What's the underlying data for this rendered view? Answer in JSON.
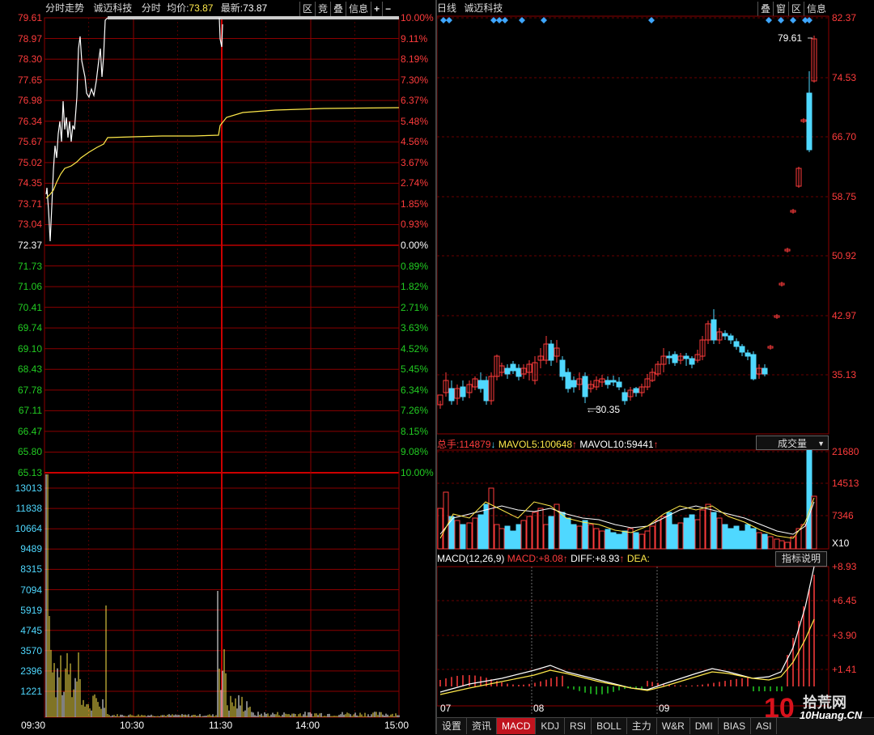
{
  "intraday": {
    "header": {
      "title": "分时走势",
      "stock": "诚迈科技",
      "mode": "分时",
      "avg_label": "均价:",
      "avg_value": "73.87",
      "last_label": "最新:",
      "last_value": "73.87",
      "buttons": [
        "区",
        "竞",
        "叠",
        "信息",
        "+",
        "−"
      ]
    },
    "price_labels": [
      "79.61",
      "78.97",
      "78.30",
      "77.65",
      "76.98",
      "76.34",
      "75.67",
      "75.02",
      "74.35",
      "73.71",
      "73.04",
      "72.37",
      "71.73",
      "71.06",
      "70.41",
      "69.74",
      "69.10",
      "68.43",
      "67.78",
      "67.11",
      "66.47",
      "65.80",
      "65.13"
    ],
    "pct_labels": [
      "10.00%",
      "9.11%",
      "8.19%",
      "7.30%",
      "6.37%",
      "5.48%",
      "4.56%",
      "3.67%",
      "2.74%",
      "1.85%",
      "0.93%",
      "0.00%",
      "0.89%",
      "1.82%",
      "2.71%",
      "3.63%",
      "4.52%",
      "5.45%",
      "6.34%",
      "7.26%",
      "8.15%",
      "9.08%",
      "10.00%"
    ],
    "volume_labels": [
      "13013",
      "11838",
      "10664",
      "9489",
      "8315",
      "7094",
      "5919",
      "4745",
      "3570",
      "2396",
      "1221"
    ],
    "time_labels": [
      "09:30",
      "10:30",
      "11:30",
      "14:00",
      "15:00"
    ],
    "colors": {
      "up": "#ff3c3c",
      "down": "#22cc22",
      "price_line": "#ffffff",
      "avg_line": "#ffe94a",
      "volume": "#ffe94a",
      "grid": "#8b0000"
    }
  },
  "daily": {
    "header": {
      "title": "日线",
      "stock": "诚迈科技",
      "buttons": [
        "叠",
        "窗",
        "区",
        "信息"
      ]
    },
    "price_labels": [
      "82.37",
      "74.53",
      "66.70",
      "58.75",
      "50.92",
      "42.97",
      "35.13"
    ],
    "annotations": {
      "high": "79.61",
      "low": "30.35"
    },
    "volume_header": {
      "total_label": "总手:",
      "total_value": "114879",
      "mavol5_label": "MAVOL5:",
      "mavol5_value": "100648",
      "mavol10_label": "MAVOL10:",
      "mavol10_value": "59441",
      "dropdown": "成交量"
    },
    "volume_labels": [
      "21680",
      "14513",
      "7346"
    ],
    "volume_unit": "X10",
    "macd_header": {
      "params": "MACD(12,26,9)",
      "macd_label": "MACD:",
      "macd_value": "+8.08",
      "diff_label": "DIFF:",
      "diff_value": "+8.93",
      "dea_label": "DEA:",
      "help": "指标说明"
    },
    "macd_labels": [
      "+8.93",
      "+6.45",
      "+3.90",
      "+1.41"
    ],
    "month_labels": [
      "07",
      "08",
      "09"
    ],
    "tabs": [
      {
        "label": "设置",
        "active": false
      },
      {
        "label": "资讯",
        "active": false
      },
      {
        "label": "MACD",
        "active": true
      },
      {
        "label": "KDJ",
        "active": false
      },
      {
        "label": "RSI",
        "active": false
      },
      {
        "label": "BOLL",
        "active": false
      },
      {
        "label": "主力",
        "active": false
      },
      {
        "label": "W&R",
        "active": false
      },
      {
        "label": "DMI",
        "active": false
      },
      {
        "label": "BIAS",
        "active": false
      },
      {
        "label": "ASI",
        "active": false
      }
    ],
    "colors": {
      "up": "#ff3c3c",
      "down": "#4fd8ff",
      "ma1": "#ffffff",
      "ma2": "#ffe94a",
      "grid": "#8b0000",
      "diamond": "#3ea6ff"
    }
  },
  "watermark": {
    "text1": "拾荒网",
    "text2": "10Huang.CN"
  }
}
